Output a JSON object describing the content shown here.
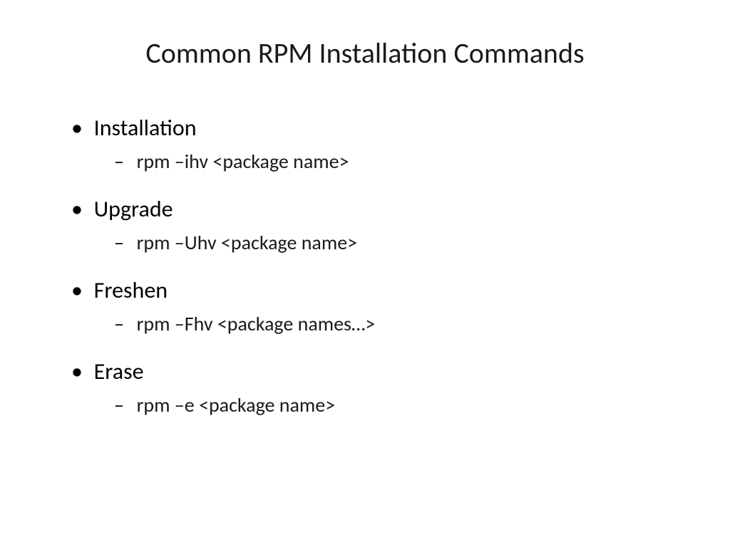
{
  "title": "Common RPM Installation Commands",
  "items": [
    {
      "label": "Installation",
      "sub": "rpm –ihv <package name>"
    },
    {
      "label": "Upgrade",
      "sub": "rpm –Uhv <package name>"
    },
    {
      "label": "Freshen",
      "sub": "rpm –Fhv <package names…>"
    },
    {
      "label": "Erase",
      "sub": "rpm –e <package name>"
    }
  ]
}
